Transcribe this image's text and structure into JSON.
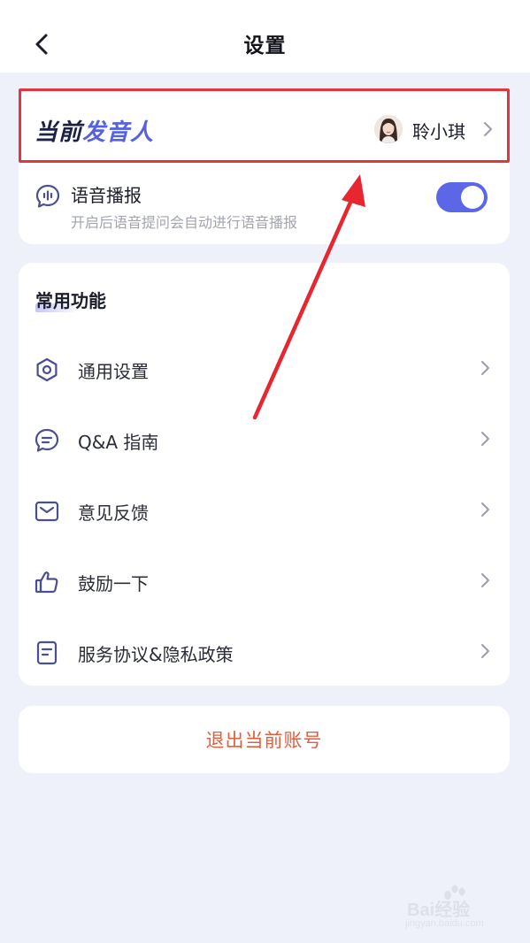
{
  "header": {
    "title": "设置",
    "back_icon": "chevron-left-icon"
  },
  "speaker": {
    "title_part1": "当前",
    "title_part2": "发音人",
    "name": "聆小琪",
    "avatar": "avatar-icon"
  },
  "voice": {
    "label": "语音播报",
    "description": "开启后语音提问会自动进行语音播报",
    "enabled": true,
    "icon": "voice-chat-icon"
  },
  "common": {
    "title": "常用功能",
    "items": [
      {
        "label": "通用设置",
        "icon": "gear-icon"
      },
      {
        "label": "Q&A 指南",
        "icon": "chat-bubble-icon"
      },
      {
        "label": "意见反馈",
        "icon": "mail-icon"
      },
      {
        "label": "鼓励一下",
        "icon": "thumbs-up-icon"
      },
      {
        "label": "服务协议&隐私政策",
        "icon": "document-icon"
      }
    ]
  },
  "logout": {
    "label": "退出当前账号"
  },
  "watermark": {
    "brand": "Bai经验",
    "url": "jingyan.baidu.com"
  },
  "colors": {
    "accent": "#5b67e6",
    "highlight_box": "#e0363f",
    "logout_text": "#e45e3c",
    "background": "#eef1fa"
  }
}
